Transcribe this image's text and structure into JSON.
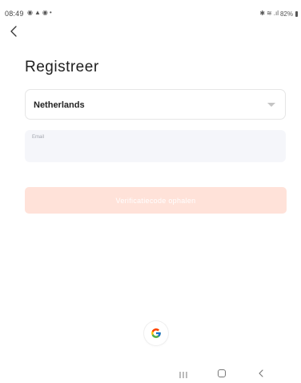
{
  "status_bar": {
    "time": "08:49",
    "battery": "82%",
    "left_icons": [
      "notification-icon",
      "app-icon",
      "notification-icon"
    ],
    "right_icons": [
      "bluetooth-icon",
      "wifi-icon",
      "signal-icon",
      "battery-icon"
    ]
  },
  "header": {
    "back_icon": "chevron-left-icon"
  },
  "form": {
    "title": "Registreer",
    "country": "Netherlands",
    "email_label": "Email",
    "submit_label": "Verificatiecode ophalen"
  },
  "social": {
    "google_icon": "google-icon"
  },
  "navigation": {
    "recents_icon": "recents-icon",
    "home_icon": "home-icon",
    "back_icon": "back-icon"
  },
  "colors": {
    "submit_button_bg": "#ffe2d9",
    "email_field_bg": "#f5f6fa",
    "text_primary": "#202020"
  }
}
